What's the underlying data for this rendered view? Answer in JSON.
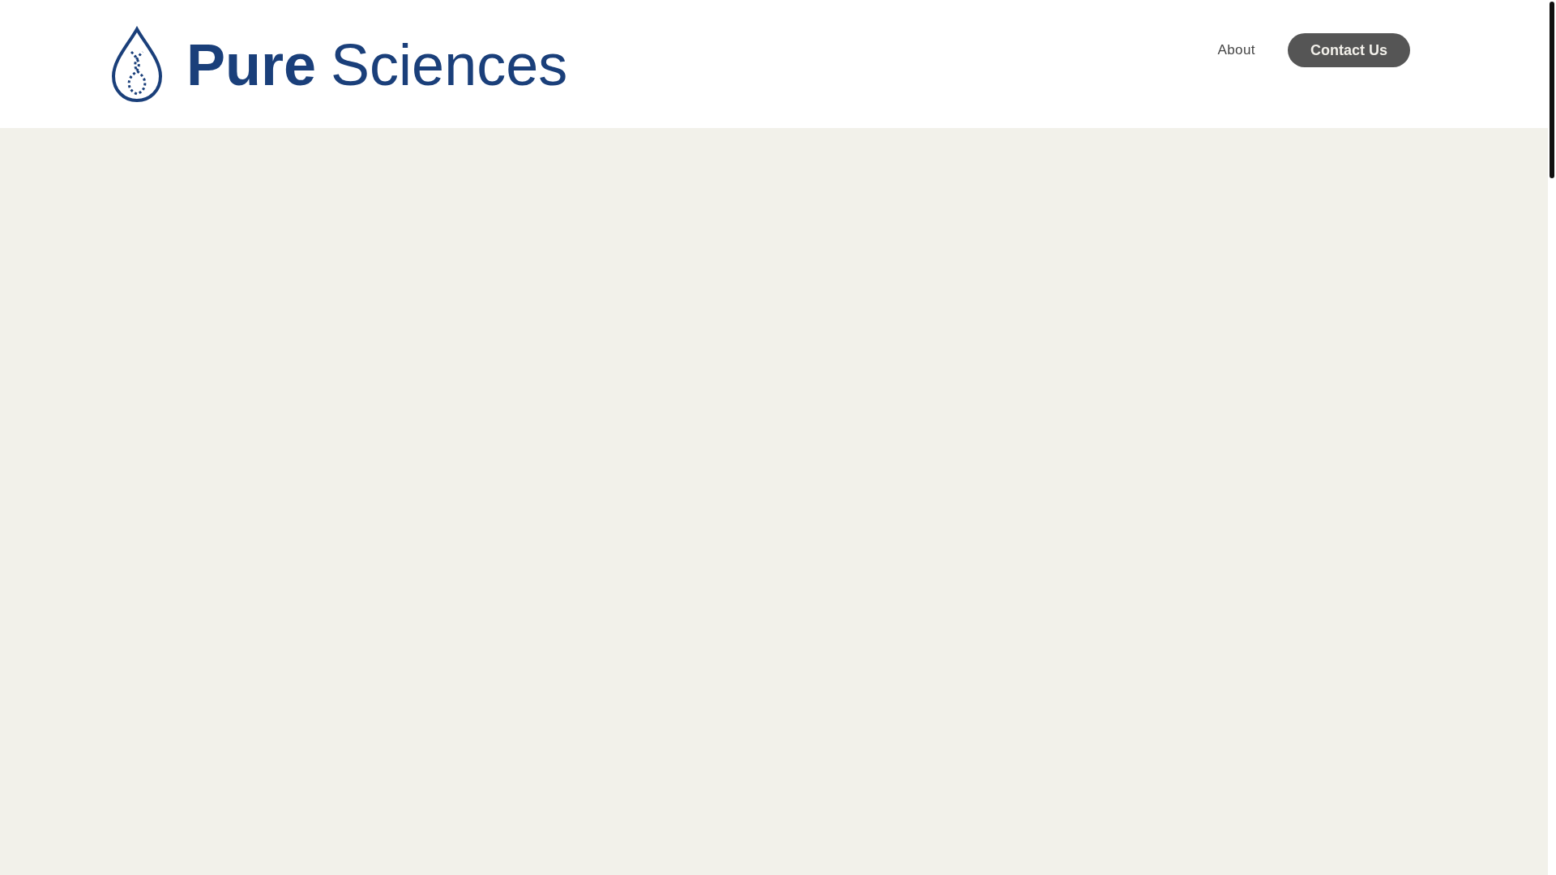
{
  "header": {
    "logo": {
      "bold_part": "Pure",
      "rest": "Sciences"
    },
    "nav": [
      {
        "kind": "link",
        "label": "About"
      },
      {
        "kind": "button",
        "label": "Contact Us"
      }
    ]
  }
}
